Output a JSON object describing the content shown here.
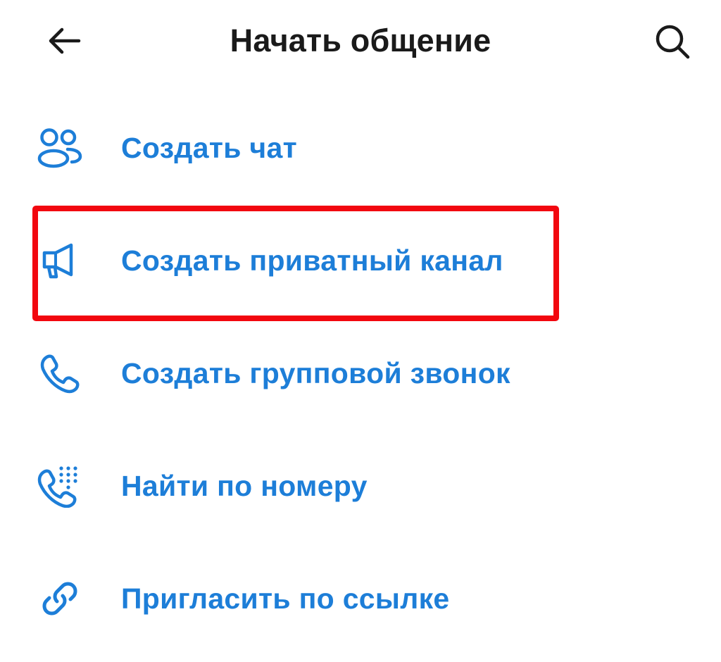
{
  "header": {
    "title": "Начать общение",
    "back_icon": "arrow-left-icon",
    "search_icon": "search-icon"
  },
  "menu": {
    "items": [
      {
        "label": "Создать чат",
        "icon": "people-icon"
      },
      {
        "label": "Создать приватный канал",
        "icon": "megaphone-icon"
      },
      {
        "label": "Создать групповой звонок",
        "icon": "phone-icon"
      },
      {
        "label": "Найти по номеру",
        "icon": "phone-dialpad-icon"
      },
      {
        "label": "Пригласить по ссылке",
        "icon": "link-icon"
      }
    ]
  },
  "colors": {
    "accent": "#1d7ed8",
    "title": "#1a1a1a",
    "highlight": "#f2070f",
    "background": "#ffffff"
  }
}
